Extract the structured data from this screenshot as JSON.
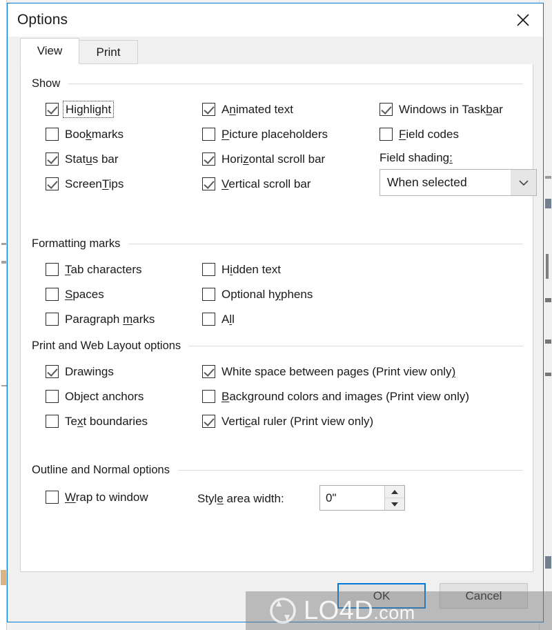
{
  "window": {
    "title": "Options",
    "close_icon": "close-icon"
  },
  "tabs": [
    {
      "label": "View",
      "active": true
    },
    {
      "label": "Print",
      "active": false
    }
  ],
  "groups": [
    {
      "id": "show",
      "title": "Show",
      "checkboxes": [
        {
          "label": "Highlight",
          "acc": "g",
          "checked": true,
          "focused": true,
          "col": 0,
          "row": 0
        },
        {
          "label": "Bookmarks",
          "acc": "k",
          "checked": false,
          "focused": false,
          "col": 0,
          "row": 1
        },
        {
          "label": "Status bar",
          "acc": "u",
          "checked": true,
          "focused": false,
          "col": 0,
          "row": 2
        },
        {
          "label": "ScreenTips",
          "acc": "T",
          "checked": true,
          "focused": false,
          "col": 0,
          "row": 3
        },
        {
          "label": "Animated text",
          "acc": "n",
          "checked": true,
          "focused": false,
          "col": 1,
          "row": 0
        },
        {
          "label": "Picture placeholders",
          "acc": "P",
          "checked": false,
          "focused": false,
          "col": 1,
          "row": 1
        },
        {
          "label": "Horizontal scroll bar",
          "acc": "z",
          "checked": true,
          "focused": false,
          "col": 1,
          "row": 2
        },
        {
          "label": "Vertical scroll bar",
          "acc": "V",
          "checked": true,
          "focused": false,
          "col": 1,
          "row": 3
        },
        {
          "label": "Windows in Taskbar",
          "acc": "b",
          "checked": true,
          "focused": false,
          "col": 2,
          "row": 0
        },
        {
          "label": "Field codes",
          "acc": "F",
          "checked": false,
          "focused": false,
          "col": 2,
          "row": 1
        }
      ],
      "field_shading": {
        "label": "Field shading:",
        "acc": ":",
        "value": "When selected",
        "arrow_icon": "chevron-down-icon"
      }
    },
    {
      "id": "formatting-marks",
      "title": "Formatting marks",
      "checkboxes": [
        {
          "label": "Tab characters",
          "acc": "T",
          "checked": false,
          "focused": false,
          "col": 0,
          "row": 0
        },
        {
          "label": "Spaces",
          "acc": "S",
          "checked": false,
          "focused": false,
          "col": 0,
          "row": 1
        },
        {
          "label": "Paragraph marks",
          "acc": "m",
          "checked": false,
          "focused": false,
          "col": 0,
          "row": 2
        },
        {
          "label": "Hidden text",
          "acc": "i",
          "checked": false,
          "focused": false,
          "col": 1,
          "row": 0
        },
        {
          "label": "Optional hyphens",
          "acc": "y",
          "checked": false,
          "focused": false,
          "col": 1,
          "row": 1
        },
        {
          "label": "All",
          "acc": "l",
          "checked": false,
          "focused": false,
          "col": 1,
          "row": 2
        }
      ]
    },
    {
      "id": "print-web-layout",
      "title": "Print and Web Layout options",
      "checkboxes": [
        {
          "label": "Drawings",
          "acc": "g",
          "checked": true,
          "focused": false,
          "col": 0,
          "row": 0
        },
        {
          "label": "Object anchors",
          "acc": "j",
          "checked": false,
          "focused": false,
          "col": 0,
          "row": 1
        },
        {
          "label": "Text boundaries",
          "acc": "x",
          "checked": false,
          "focused": false,
          "col": 0,
          "row": 2
        },
        {
          "label": "White space between pages (Print view only)",
          "acc": ")",
          "checked": true,
          "focused": false,
          "col": 1,
          "row": 0
        },
        {
          "label": "Background colors and images (Print view only)",
          "acc": "B",
          "checked": false,
          "focused": false,
          "col": 1,
          "row": 1
        },
        {
          "label": "Vertical ruler (Print view only)",
          "acc": "c",
          "checked": true,
          "focused": false,
          "col": 1,
          "row": 2
        }
      ]
    },
    {
      "id": "outline-normal",
      "title": "Outline and Normal options",
      "checkboxes": [
        {
          "label": "Wrap to window",
          "acc": "W",
          "checked": false,
          "focused": false,
          "col": 0,
          "row": 0
        }
      ],
      "style_area": {
        "label": "Style area width:",
        "acc": "e",
        "value": "0\"",
        "up_icon": "spinner-up-icon",
        "down_icon": "spinner-down-icon"
      }
    }
  ],
  "footer": {
    "ok_label": "OK",
    "cancel_label": "Cancel"
  },
  "watermark": {
    "brand": "LO4D",
    "suffix": ".com",
    "logo_icon": "refresh-circle-icon"
  },
  "colors": {
    "accent": "#0078d7",
    "dialog_bg": "#f0f0f0",
    "panel_bg": "#ffffff",
    "text": "#1a1a1a",
    "rule": "#dcdcdc"
  }
}
